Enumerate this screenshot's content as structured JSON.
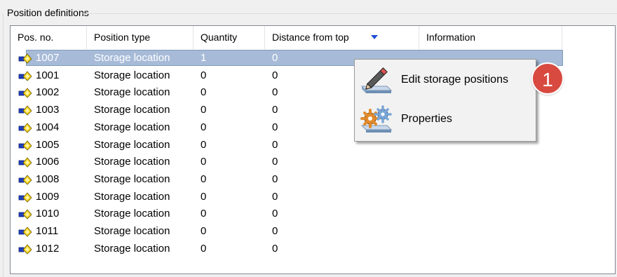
{
  "group": {
    "title": "Position definitions"
  },
  "columns": [
    "Pos. no.",
    "Position type",
    "Quantity",
    "Distance from top",
    "Information"
  ],
  "sort_column_index": 3,
  "rows": [
    {
      "pos": "1007",
      "type": "Storage location",
      "qty": "1",
      "dist": "0",
      "selected": true
    },
    {
      "pos": "1001",
      "type": "Storage location",
      "qty": "0",
      "dist": "0"
    },
    {
      "pos": "1002",
      "type": "Storage location",
      "qty": "0",
      "dist": "0"
    },
    {
      "pos": "1003",
      "type": "Storage location",
      "qty": "0",
      "dist": "0"
    },
    {
      "pos": "1004",
      "type": "Storage location",
      "qty": "0",
      "dist": "0"
    },
    {
      "pos": "1005",
      "type": "Storage location",
      "qty": "0",
      "dist": "0"
    },
    {
      "pos": "1006",
      "type": "Storage location",
      "qty": "0",
      "dist": "0"
    },
    {
      "pos": "1008",
      "type": "Storage location",
      "qty": "0",
      "dist": "0"
    },
    {
      "pos": "1009",
      "type": "Storage location",
      "qty": "0",
      "dist": "0"
    },
    {
      "pos": "1010",
      "type": "Storage location",
      "qty": "0",
      "dist": "0"
    },
    {
      "pos": "1011",
      "type": "Storage location",
      "qty": "0",
      "dist": "0"
    },
    {
      "pos": "1012",
      "type": "Storage location",
      "qty": "0",
      "dist": "0"
    }
  ],
  "row_icon": "storage-location-icon",
  "context_menu": {
    "items": [
      {
        "label": "Edit storage positions",
        "icon": "pencil-edit-icon"
      },
      {
        "label": "Properties",
        "icon": "gears-properties-icon"
      }
    ]
  },
  "callout": {
    "number": "1"
  },
  "colors": {
    "selection": "#a7bbd8",
    "sort_arrow": "#1f4fd6",
    "callout": "#d84a3f"
  }
}
